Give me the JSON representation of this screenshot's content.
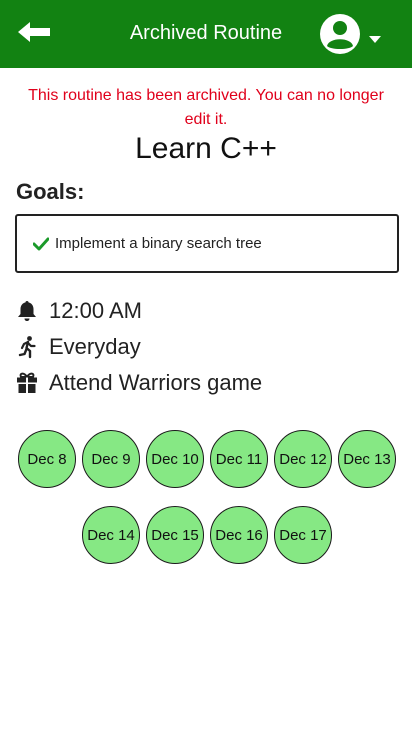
{
  "header": {
    "title": "Archived Routine",
    "bg_color": "#128212"
  },
  "warning": "This routine has been archived. You can no longer edit it.",
  "routine": {
    "name": "Learn C++",
    "goals_label": "Goals:",
    "goals": [
      {
        "text": "Implement a binary search tree",
        "done": true
      }
    ],
    "time": "12:00 AM",
    "frequency": "Everyday",
    "reward": "Attend Warriors game"
  },
  "days": [
    "Dec 8",
    "Dec 9",
    "Dec 10",
    "Dec 11",
    "Dec 12",
    "Dec 13",
    "Dec 14",
    "Dec 15",
    "Dec 16",
    "Dec 17"
  ],
  "colors": {
    "accent": "#128212",
    "warning": "#e0001b",
    "day_fill": "#86e884",
    "check": "#1b9a2a"
  }
}
